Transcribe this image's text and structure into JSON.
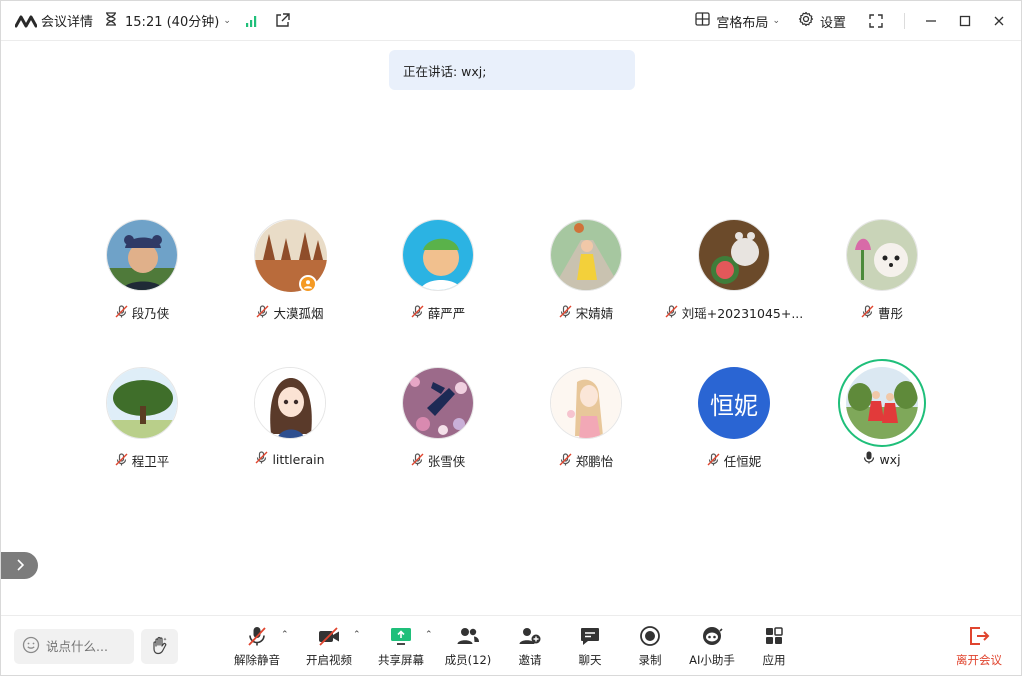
{
  "titlebar": {
    "meeting_details": "会议详情",
    "time": "15:21 (40分钟)",
    "layout_label": "宫格布局",
    "settings_label": "设置"
  },
  "speaking": {
    "text": "正在讲话: wxj;"
  },
  "participants": [
    {
      "name": "段乃侠",
      "mic": "muted"
    },
    {
      "name": "大漠孤烟",
      "mic": "muted",
      "host": true
    },
    {
      "name": "薛严严",
      "mic": "muted"
    },
    {
      "name": "宋婧婧",
      "mic": "muted"
    },
    {
      "name": "刘瑶+20231045+...",
      "mic": "muted"
    },
    {
      "name": "曹彤",
      "mic": "muted"
    },
    {
      "name": "程卫平",
      "mic": "muted"
    },
    {
      "name": "littlerain",
      "mic": "muted"
    },
    {
      "name": "张雪侠",
      "mic": "muted"
    },
    {
      "name": "郑鹏怡",
      "mic": "muted"
    },
    {
      "name": "任恒妮",
      "mic": "muted",
      "avatar_text": "恒妮"
    },
    {
      "name": "wxj",
      "mic": "on",
      "speaking": true
    }
  ],
  "toolbar": {
    "chat_placeholder": "说点什么...",
    "unmute": "解除静音",
    "start_video": "开启视频",
    "share_screen": "共享屏幕",
    "members": "成员(12)",
    "invite": "邀请",
    "chat": "聊天",
    "record": "录制",
    "ai_assistant": "AI小助手",
    "apps": "应用",
    "leave": "离开会议"
  },
  "colors": {
    "accent_green": "#1fbf7a",
    "muted_red": "#e0452f",
    "avatar_blue": "#2a65d3",
    "host_badge": "#f59a23"
  }
}
